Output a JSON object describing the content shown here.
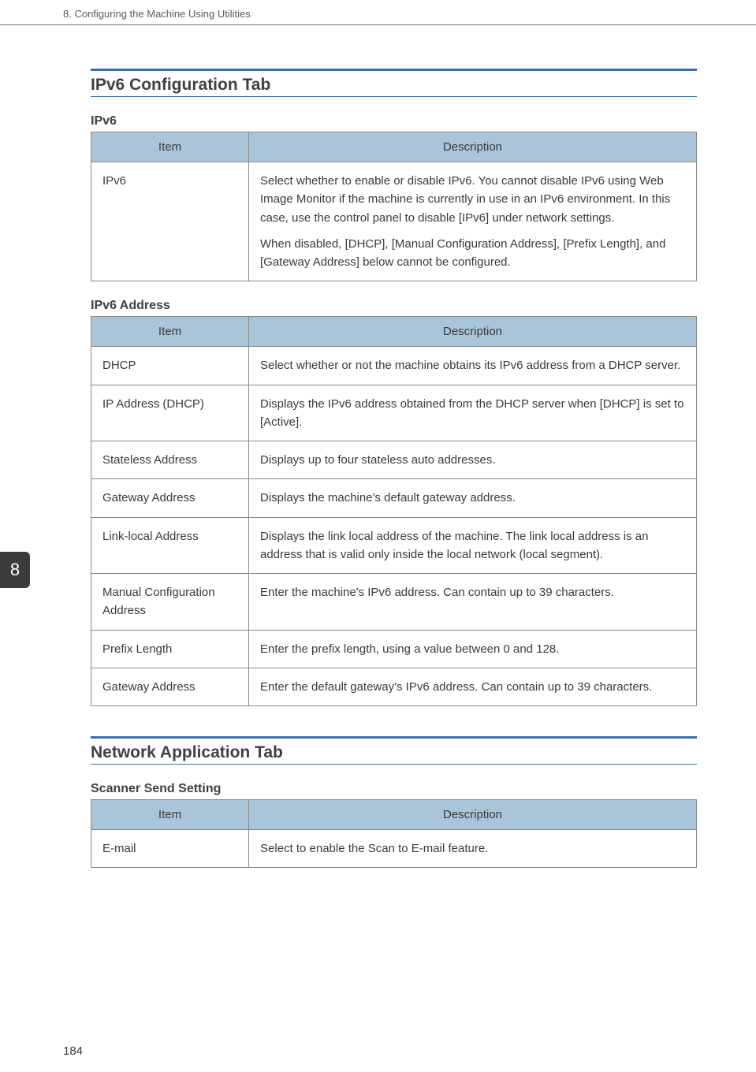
{
  "page": {
    "running_header": "8. Configuring the Machine Using Utilities",
    "page_number": "184",
    "side_tab": "8"
  },
  "section1": {
    "heading": "IPv6 Configuration Tab",
    "sub1": {
      "title": "IPv6",
      "col_item": "Item",
      "col_desc": "Description",
      "rows": [
        {
          "item": "IPv6",
          "desc_p1": "Select whether to enable or disable IPv6. You cannot disable IPv6 using Web Image Monitor if the machine is currently in use in an IPv6 environment. In this case, use the control panel to disable [IPv6] under network settings.",
          "desc_p2": "When disabled, [DHCP], [Manual Configuration Address], [Prefix Length], and [Gateway Address] below cannot be configured."
        }
      ]
    },
    "sub2": {
      "title": "IPv6 Address",
      "col_item": "Item",
      "col_desc": "Description",
      "rows": [
        {
          "item": "DHCP",
          "desc": "Select whether or not the machine obtains its IPv6 address from a DHCP server."
        },
        {
          "item": "IP Address (DHCP)",
          "desc": "Displays the IPv6 address obtained from the DHCP server when [DHCP] is set to [Active]."
        },
        {
          "item": "Stateless Address",
          "desc": "Displays up to four stateless auto addresses."
        },
        {
          "item": "Gateway Address",
          "desc": "Displays the machine's default gateway address."
        },
        {
          "item": "Link-local Address",
          "desc": "Displays the link local address of the machine. The link local address is an address that is valid only inside the local network (local segment)."
        },
        {
          "item": "Manual Configuration Address",
          "desc": "Enter the machine's IPv6 address. Can contain up to 39 characters."
        },
        {
          "item": "Prefix Length",
          "desc": "Enter the prefix length, using a value between 0 and 128."
        },
        {
          "item": "Gateway Address",
          "desc": "Enter the default gateway's IPv6 address. Can contain up to 39 characters."
        }
      ]
    }
  },
  "section2": {
    "heading": "Network Application Tab",
    "sub1": {
      "title": "Scanner Send Setting",
      "col_item": "Item",
      "col_desc": "Description",
      "rows": [
        {
          "item": "E-mail",
          "desc": "Select to enable the Scan to E-mail feature."
        }
      ]
    }
  }
}
